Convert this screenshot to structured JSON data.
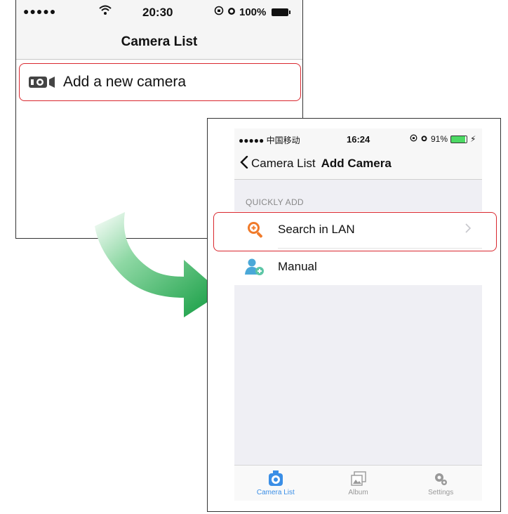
{
  "screen1": {
    "status": {
      "signal": "●●●●●",
      "time": "20:30",
      "battery": "100%"
    },
    "nav_title": "Camera List",
    "add_camera_label": "Add a new camera"
  },
  "screen2": {
    "status": {
      "carrier": "●●●●● 中国移动",
      "time": "16:24",
      "battery": "91%"
    },
    "nav": {
      "back_label": "Camera List",
      "title": "Add Camera"
    },
    "section_header": "QUICKLY ADD",
    "rows": [
      {
        "label": "Search in LAN",
        "icon": "search-plus-icon"
      },
      {
        "label": "Manual",
        "icon": "add-user-icon"
      }
    ],
    "tabs": [
      {
        "label": "Camera List",
        "icon": "camera-icon",
        "active": true
      },
      {
        "label": "Album",
        "icon": "album-icon",
        "active": false
      },
      {
        "label": "Settings",
        "icon": "gear-icon",
        "active": false
      }
    ]
  },
  "colors": {
    "highlight": "#d9272e",
    "accent": "#3a8ee6",
    "search_icon": "#f07a2a",
    "manual_icon": "#4aa8d8",
    "arrow": "#1aa34a"
  }
}
